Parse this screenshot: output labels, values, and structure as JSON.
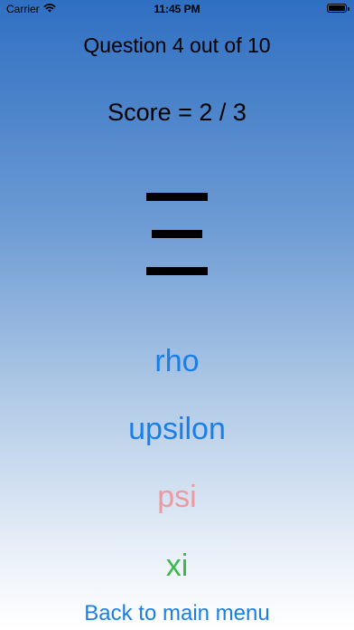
{
  "status_bar": {
    "carrier": "Carrier",
    "time": "11:45 PM"
  },
  "quiz": {
    "question_label": "Question 4 out of 10",
    "score_label": "Score = 2 / 3",
    "symbol_glyph": "Ξ"
  },
  "answers": [
    {
      "label": "rho",
      "color": "#1a7ee8"
    },
    {
      "label": "upsilon",
      "color": "#1a7ee8"
    },
    {
      "label": "psi",
      "color": "#eb9ba0"
    },
    {
      "label": "xi",
      "color": "#3cb84c"
    }
  ],
  "navigation": {
    "back_label": "Back to main menu",
    "link_color": "#1a7ee8"
  },
  "icons": {
    "wifi": "wifi-icon",
    "battery": "battery-icon"
  }
}
